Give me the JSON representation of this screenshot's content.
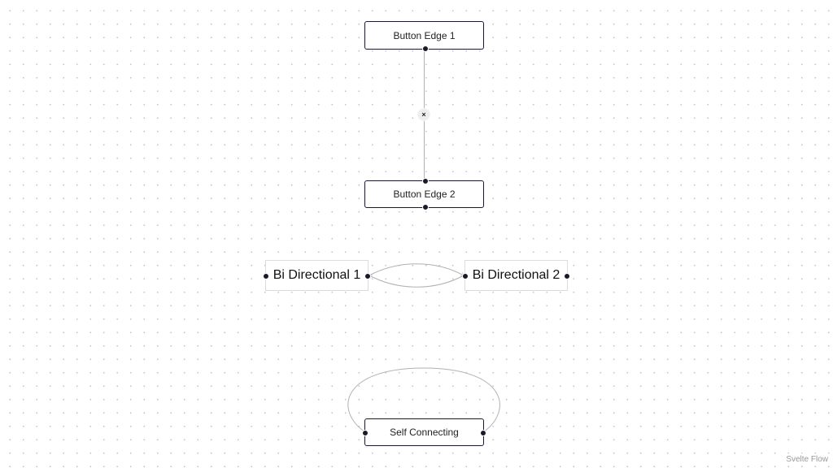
{
  "nodes": {
    "button_edge_1": {
      "label": "Button Edge 1"
    },
    "button_edge_2": {
      "label": "Button Edge 2"
    },
    "bi_directional_1": {
      "label": "Bi Directional 1"
    },
    "bi_directional_2": {
      "label": "Bi Directional 2"
    },
    "self_connecting": {
      "label": "Self Connecting"
    }
  },
  "edges": {
    "button_edge": {
      "button_label": "×",
      "button_icon": "close-icon"
    }
  },
  "attribution": {
    "label": "Svelte Flow"
  },
  "colors": {
    "edge": "#b1b1b7",
    "node_border": "#1a192b",
    "handle": "#1a192b",
    "background_dots": "#c8c8c8"
  }
}
